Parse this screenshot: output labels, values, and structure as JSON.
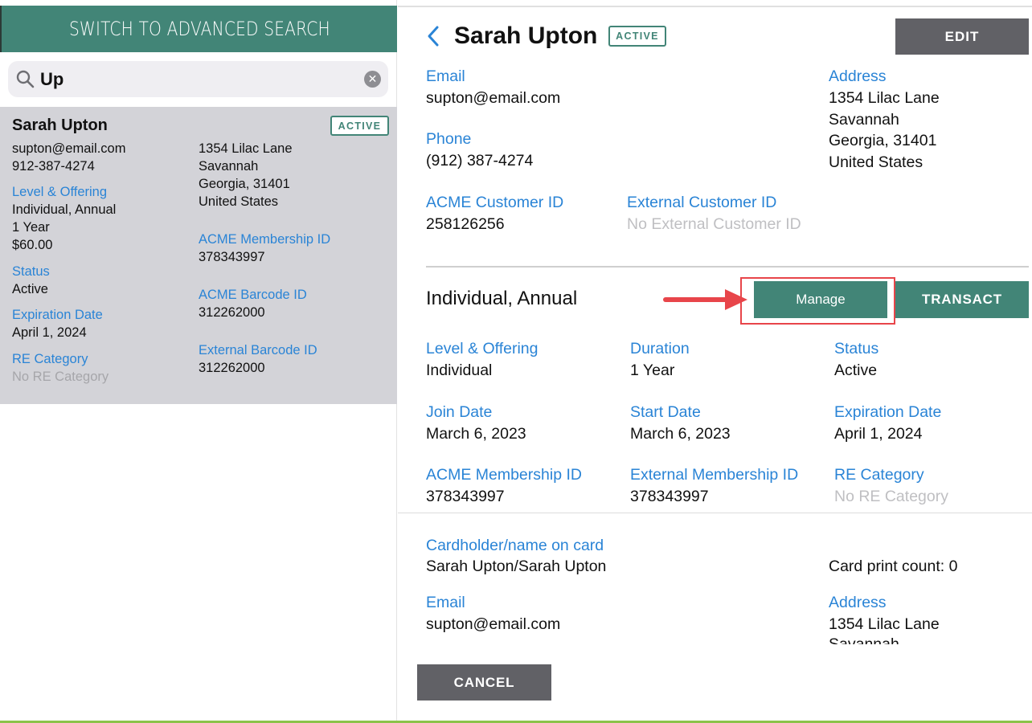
{
  "search": {
    "advanced_label": "SWITCH TO ADVANCED SEARCH",
    "query": "Up"
  },
  "result": {
    "name": "Sarah Upton",
    "badge": "ACTIVE",
    "email": "supton@email.com",
    "phone": "912-387-4274",
    "level_label": "Level & Offering",
    "level_value": "Individual, Annual",
    "duration": "1 Year",
    "price": "$60.00",
    "status_label": "Status",
    "status_value": "Active",
    "expiration_label": "Expiration Date",
    "expiration_value": "April 1, 2024",
    "re_label": "RE Category",
    "re_value": "No RE Category",
    "address": [
      "1354 Lilac Lane",
      "Savannah",
      "Georgia, 31401",
      "United States"
    ],
    "membership_id_label": "ACME Membership ID",
    "membership_id_value": "378343997",
    "barcode_label": "ACME Barcode ID",
    "barcode_value": "312262000",
    "ext_barcode_label": "External Barcode ID",
    "ext_barcode_value": "312262000"
  },
  "detail": {
    "name": "Sarah Upton",
    "badge": "ACTIVE",
    "edit_label": "EDIT",
    "email_label": "Email",
    "email_value": "supton@email.com",
    "phone_label": "Phone",
    "phone_value": "(912) 387-4274",
    "address_label": "Address",
    "address": [
      "1354 Lilac Lane",
      "Savannah",
      "Georgia, 31401",
      "United States"
    ],
    "customer_id_label": "ACME Customer ID",
    "customer_id_value": "258126256",
    "ext_customer_id_label": "External Customer ID",
    "ext_customer_id_value": "No External Customer ID"
  },
  "membership": {
    "title": "Individual, Annual",
    "manage_label": "Manage",
    "transact_label": "TRANSACT",
    "level_label": "Level & Offering",
    "level_value": "Individual",
    "duration_label": "Duration",
    "duration_value": "1 Year",
    "status_label": "Status",
    "status_value": "Active",
    "join_label": "Join Date",
    "join_value": "March 6, 2023",
    "start_label": "Start Date",
    "start_value": "March 6, 2023",
    "expiration_label": "Expiration Date",
    "expiration_value": "April 1, 2024",
    "acme_id_label": "ACME Membership ID",
    "acme_id_value": "378343997",
    "ext_id_label": "External Membership ID",
    "ext_id_value": "378343997",
    "re_label": "RE Category",
    "re_value": "No RE Category"
  },
  "cardholder": {
    "label": "Cardholder/name on card",
    "value": "Sarah Upton/Sarah Upton",
    "print_count": "Card print count: 0",
    "email_label": "Email",
    "email_value": "supton@email.com",
    "address_label": "Address",
    "address_line1": "1354 Lilac Lane",
    "address_line2": "Savannah"
  },
  "footer": {
    "cancel_label": "CANCEL"
  },
  "colors": {
    "teal": "#428577",
    "link_blue": "#2a84d6",
    "gray_button": "#616166",
    "highlight_red": "#e8454a",
    "accent_green": "#8bc34a"
  }
}
